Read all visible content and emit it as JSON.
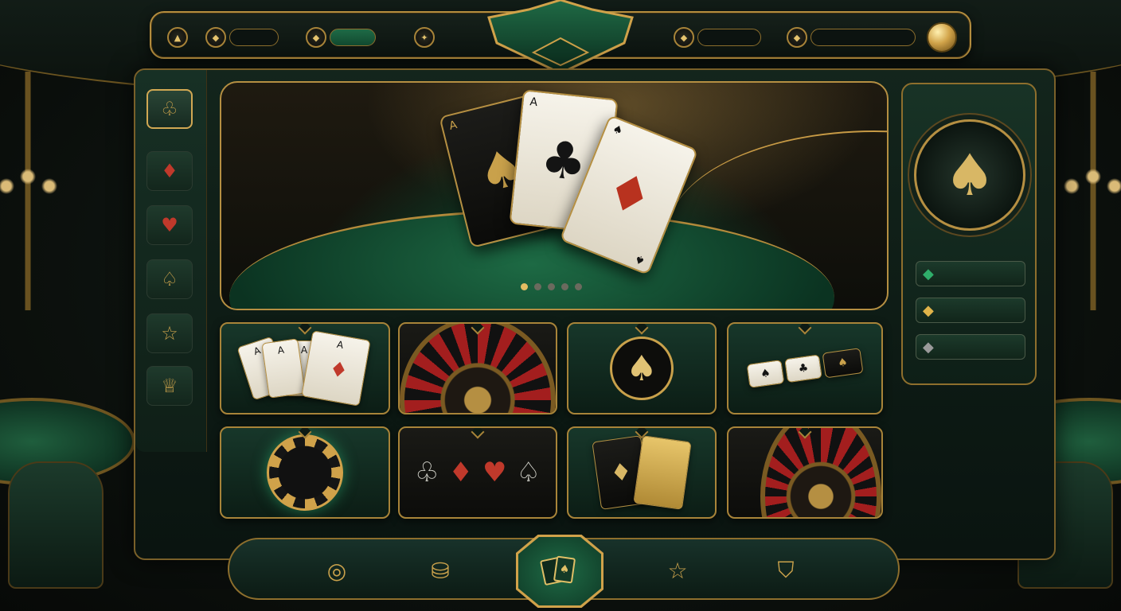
{
  "theme": {
    "gold": "#d0a24a",
    "felt_green": "#1b6a44",
    "card_red": "#c0392b",
    "dark": "#0d1a14"
  },
  "top_bar": {
    "items": [
      {
        "icon": "triangle-icon"
      },
      {
        "icon": "gem-icon",
        "value": ""
      },
      {
        "icon": "gem-icon",
        "value": ""
      },
      {
        "icon": "compass-icon"
      },
      {
        "icon": "gem-icon",
        "value": ""
      },
      {
        "icon": "gem-icon",
        "value": ""
      },
      {
        "icon": "gold-orb-icon"
      }
    ]
  },
  "sidebar": {
    "items": [
      {
        "name": "clubs",
        "glyph": "♧",
        "active": true
      },
      {
        "name": "diamonds",
        "glyph": "♦",
        "active": false
      },
      {
        "name": "hearts",
        "glyph": "♥",
        "active": false
      },
      {
        "name": "spades",
        "glyph": "♤",
        "active": false
      },
      {
        "name": "favorites",
        "glyph": "☆",
        "active": false
      },
      {
        "name": "vip",
        "glyph": "♕",
        "active": false
      }
    ]
  },
  "hero": {
    "cards": [
      {
        "rank": "A",
        "suit": "♠",
        "style": "black"
      },
      {
        "rank": "A",
        "suit": "♣",
        "style": "white"
      },
      {
        "rank": "♠",
        "suit": "♦",
        "style": "white"
      }
    ],
    "slide_count": 5,
    "active_slide": 1
  },
  "right_panel": {
    "badge_glyph": "♠",
    "rows": [
      {
        "gem": "◆",
        "color": "#2fae6a",
        "value": ""
      },
      {
        "gem": "◆",
        "color": "#e0b44a",
        "value": ""
      },
      {
        "gem": "◆",
        "color": "#9a9a9a",
        "value": ""
      }
    ]
  },
  "tiles": [
    {
      "name": "poker-cards",
      "card_ranks": [
        "A",
        "A",
        "A",
        "A"
      ]
    },
    {
      "name": "roulette"
    },
    {
      "name": "spade-coin",
      "glyph": "♠"
    },
    {
      "name": "card-table"
    },
    {
      "name": "chip"
    },
    {
      "name": "suits",
      "glyphs": [
        "♧",
        "♦",
        "♥",
        "♤"
      ]
    },
    {
      "name": "card-pair",
      "glyph": "♦"
    },
    {
      "name": "roulette-closeup"
    }
  ],
  "bottom_nav": {
    "items": [
      {
        "name": "compass",
        "glyph": "◎"
      },
      {
        "name": "chips",
        "glyph": "⛁"
      },
      {
        "name": "cards",
        "glyph": "🂡"
      },
      {
        "name": "favorites",
        "glyph": "☆"
      },
      {
        "name": "shield",
        "glyph": "⛉"
      }
    ],
    "active": "cards"
  }
}
